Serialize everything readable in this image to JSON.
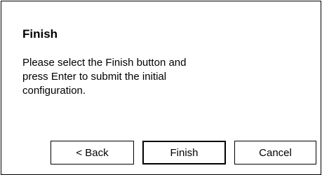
{
  "dialog": {
    "title": "Finish",
    "message_lines": [
      "Please select the Finish button and",
      "press Enter to submit the initial",
      "configuration."
    ]
  },
  "buttons": {
    "back_label": "< Back",
    "finish_label": "Finish",
    "cancel_label": "Cancel"
  },
  "colors": {
    "background": "#ffffff",
    "border": "#000000",
    "text": "#000000"
  }
}
